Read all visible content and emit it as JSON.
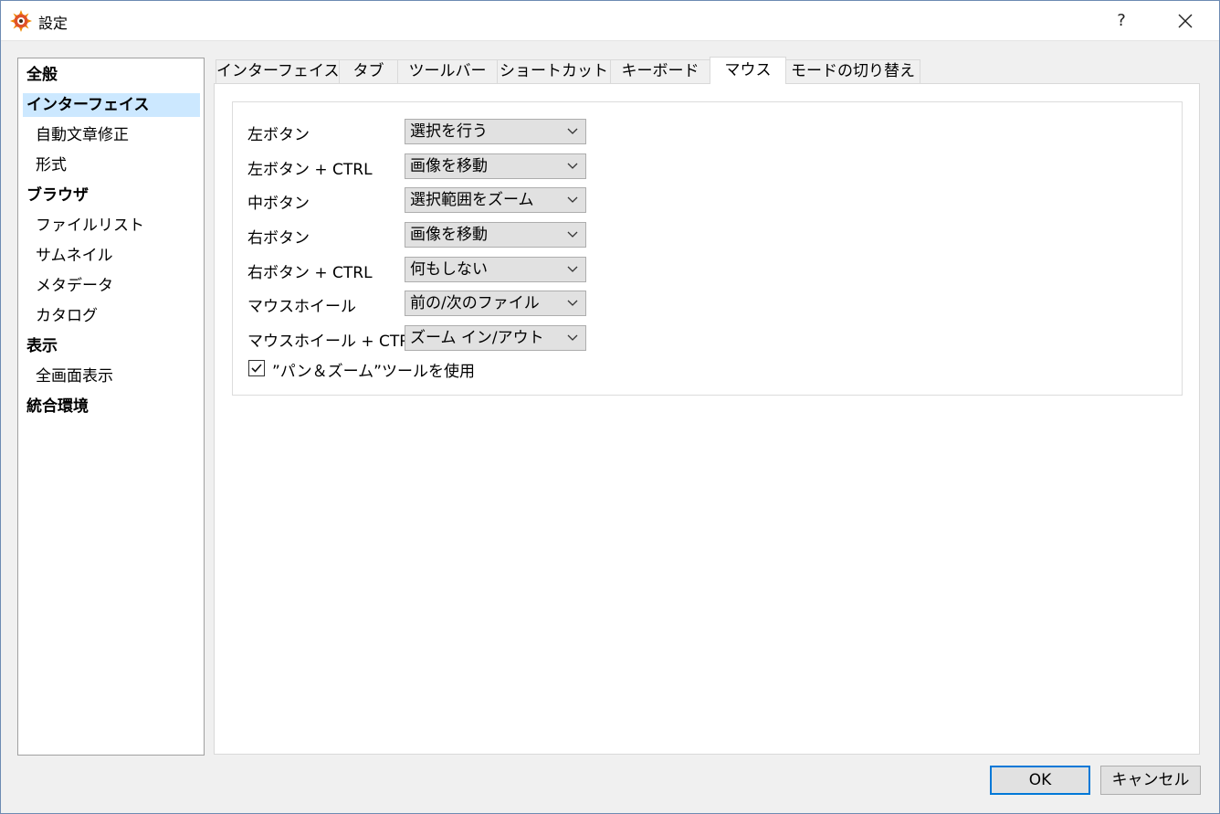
{
  "window": {
    "title": "設定",
    "help_label": "?"
  },
  "nav": {
    "items": [
      {
        "label": "全般",
        "level": 0,
        "selected": false
      },
      {
        "label": "インターフェイス",
        "level": 0,
        "selected": true
      },
      {
        "label": "自動文章修正",
        "level": 1,
        "selected": false
      },
      {
        "label": "形式",
        "level": 1,
        "selected": false
      },
      {
        "label": "ブラウザ",
        "level": 0,
        "selected": false
      },
      {
        "label": "ファイルリスト",
        "level": 1,
        "selected": false
      },
      {
        "label": "サムネイル",
        "level": 1,
        "selected": false
      },
      {
        "label": "メタデータ",
        "level": 1,
        "selected": false
      },
      {
        "label": "カタログ",
        "level": 1,
        "selected": false
      },
      {
        "label": "表示",
        "level": 0,
        "selected": false
      },
      {
        "label": "全画面表示",
        "level": 1,
        "selected": false
      },
      {
        "label": "統合環境",
        "level": 0,
        "selected": false
      }
    ]
  },
  "tabs": [
    {
      "label": "インターフェイス",
      "active": false
    },
    {
      "label": "タブ",
      "active": false
    },
    {
      "label": "ツールバー",
      "active": false
    },
    {
      "label": "ショートカット",
      "active": false
    },
    {
      "label": "キーボード",
      "active": false
    },
    {
      "label": "マウス",
      "active": true
    },
    {
      "label": "モードの切り替え",
      "active": false
    }
  ],
  "mouse": {
    "rows": [
      {
        "label": "左ボタン",
        "value": "選択を行う"
      },
      {
        "label": "左ボタン + CTRL",
        "value": "画像を移動"
      },
      {
        "label": "中ボタン",
        "value": "選択範囲をズーム"
      },
      {
        "label": "右ボタン",
        "value": "画像を移動"
      },
      {
        "label": "右ボタン + CTRL",
        "value": "何もしない"
      },
      {
        "label": "マウスホイール",
        "value": "前の/次のファイル"
      },
      {
        "label": "マウスホイール + CTRL",
        "value": "ズーム イン/アウト"
      }
    ],
    "pan_zoom": {
      "label": "”パン＆ズーム”ツールを使用",
      "checked": true
    }
  },
  "buttons": {
    "ok": "OK",
    "cancel": "キャンセル"
  },
  "colors": {
    "selection": "#cce8ff",
    "accent": "#0078d7"
  }
}
